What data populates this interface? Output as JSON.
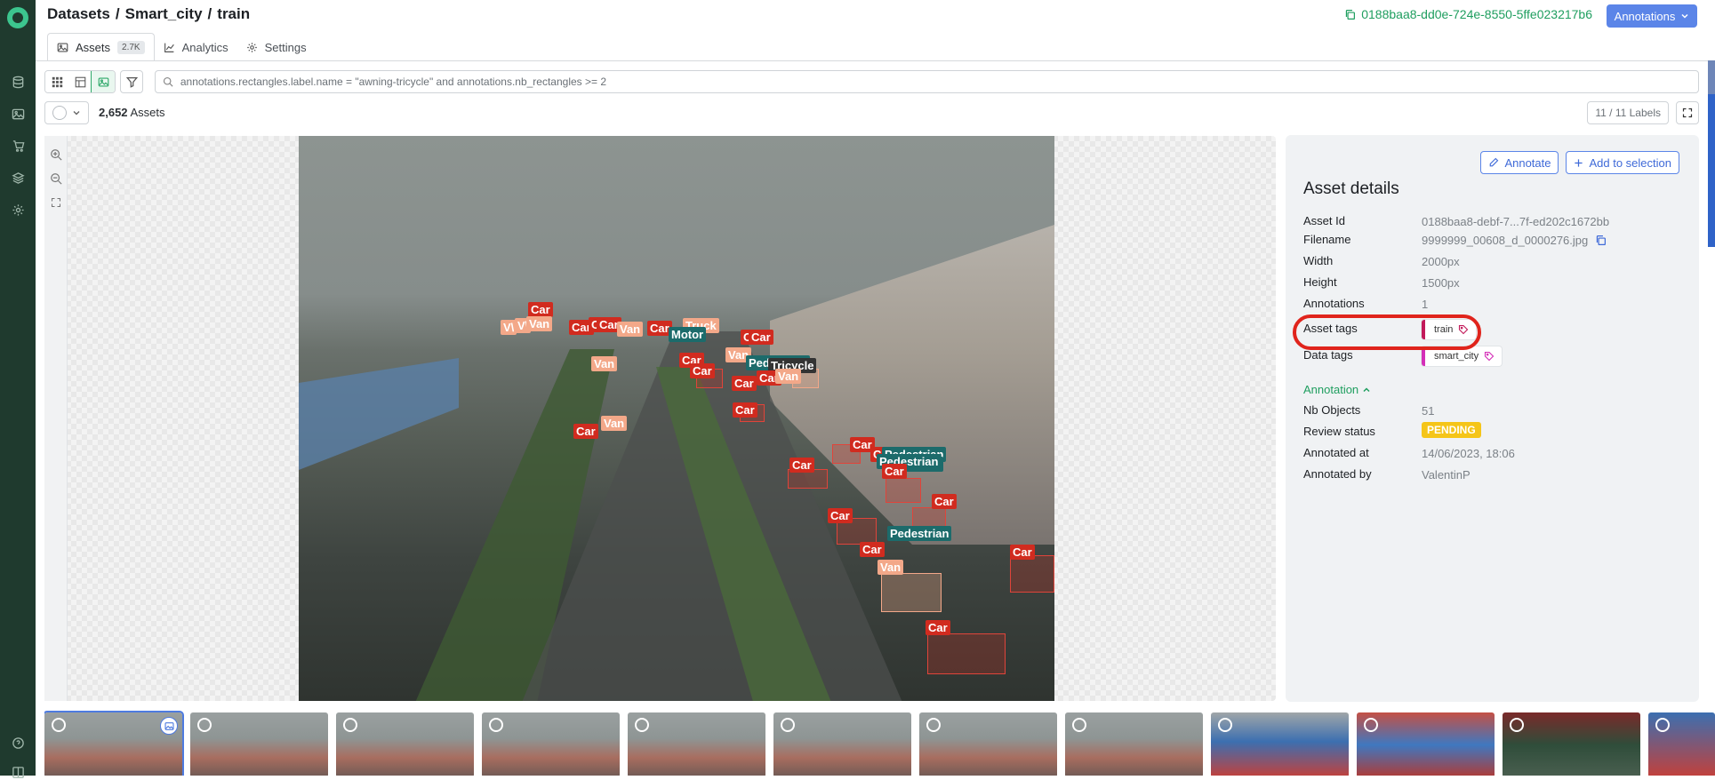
{
  "breadcrumb": [
    "Datasets",
    "/",
    "Smart_city",
    "/",
    "train"
  ],
  "dataset_version_id": "0188baa8-dd0e-724e-8550-5ffe023217b6",
  "annotations_button": "Annotations",
  "tabs": [
    {
      "label": "Assets",
      "count": "2.7K",
      "icon": "image-icon",
      "active": true
    },
    {
      "label": "Analytics",
      "icon": "chart-icon"
    },
    {
      "label": "Settings",
      "icon": "gear-icon"
    }
  ],
  "search": {
    "value": "annotations.rectangles.label.name = \"awning-tricycle\" and annotations.nb_rectangles >= 2"
  },
  "asset_count": {
    "number": "2,652",
    "label": "Assets"
  },
  "labels_filter": "11 / 11 Labels",
  "details": {
    "annotate_button": "Annotate",
    "add_selection_button": "Add to selection",
    "title": "Asset details",
    "rows": [
      {
        "label": "Asset Id",
        "value": "0188baa8-debf-7...7f-ed202c1672bb"
      },
      {
        "label": "Filename",
        "value": "9999999_00608_d_0000276.jpg"
      },
      {
        "label": "Width",
        "value": "2000px"
      },
      {
        "label": "Height",
        "value": "1500px"
      },
      {
        "label": "Annotations",
        "value": "1"
      },
      {
        "label": "Asset tags",
        "value": "train"
      },
      {
        "label": "Data tags",
        "value": "smart_city"
      }
    ],
    "annotation_header": "Annotation",
    "annotation_rows": [
      {
        "label": "Nb Objects",
        "value": "51"
      },
      {
        "label": "Review status",
        "value": "PENDING"
      },
      {
        "label": "Annotated at",
        "value": "14/06/2023, 18:06"
      },
      {
        "label": "Annotated by",
        "value": "ValentinP"
      }
    ]
  },
  "image_labels": {
    "car": "Car",
    "van": "Van",
    "pedestrian": "Pedestrian",
    "motor": "Motor",
    "tricycle": "Tricycle",
    "truck": "Truck",
    "car_prefix": "C",
    "van_fragment": "V\\"
  },
  "colors": {
    "accent": "#1f9e5f",
    "primary": "#5b85e8",
    "car": "#d12b1f",
    "van": "#f3a889",
    "pedestrian": "#1c6b6b",
    "pending": "#f5c518",
    "highlight": "#e0241c"
  },
  "sidebar_icons": [
    "logo",
    "database-icon",
    "image-icon",
    "store-icon",
    "layers-icon",
    "settings-cog-icon",
    "help-icon",
    "book-icon"
  ]
}
